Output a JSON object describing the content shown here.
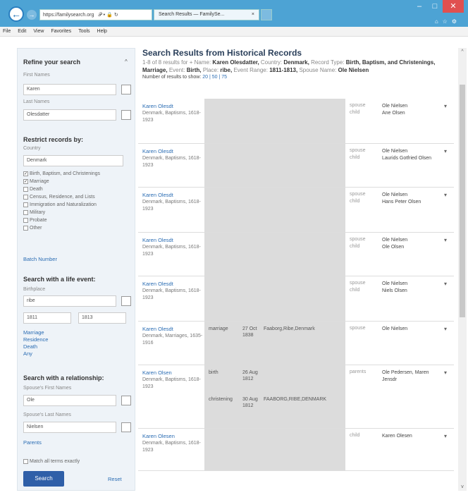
{
  "browser": {
    "address": "https://familysearch.org",
    "address_icons": "𝒫 ▾ 🔒 ↻",
    "tab_title": "Search Results — FamilySe...",
    "menu": [
      "File",
      "Edit",
      "View",
      "Favorites",
      "Tools",
      "Help"
    ]
  },
  "sidebar": {
    "refine_title": "Refine your search",
    "first_names_label": "First Names",
    "first_names_value": "Karen",
    "last_names_label": "Last Names",
    "last_names_value": "Olesdatter",
    "restrict_title": "Restrict records by:",
    "country_label": "Country",
    "country_value": "Denmark",
    "record_types": [
      {
        "label": "Birth, Baptism, and Christenings",
        "checked": true
      },
      {
        "label": "Marriage",
        "checked": true
      },
      {
        "label": "Death",
        "checked": false
      },
      {
        "label": "Census, Residence, and Lists",
        "checked": false
      },
      {
        "label": "Immigration and Naturalization",
        "checked": false
      },
      {
        "label": "Military",
        "checked": false
      },
      {
        "label": "Probate",
        "checked": false
      },
      {
        "label": "Other",
        "checked": false
      }
    ],
    "birth_number_link": "Batch Number",
    "life_event_title": "Search with a life event:",
    "birthplace_label": "Birthplace",
    "birthplace_value": "ribe",
    "year_from": "1811",
    "year_to": "1813",
    "event_links": [
      "Marriage",
      "Residence",
      "Death",
      "Any"
    ],
    "relationship_title": "Search with a relationship:",
    "spouse_first_label": "Spouse's First Names",
    "spouse_first_value": "Ole",
    "spouse_last_label": "Spouse's Last Names",
    "spouse_last_value": "Nielsen",
    "parents_link": "Parents",
    "match_exact_label": "Match all terms exactly",
    "search_button": "Search",
    "reset_link": "Reset"
  },
  "main": {
    "title": "Search Results from Historical Records",
    "summary_prefix": "1-8 of 8 results for",
    "summary_plus": "+ Name:",
    "summary_name": "Karen Olesdatter,",
    "summary_country_lbl": "Country:",
    "summary_country": "Denmark,",
    "summary_rt_lbl": "Record Type:",
    "summary_rt": "Birth, Baptism, and Christenings, Marriage,",
    "summary_event_lbl": "Event:",
    "summary_event": "Birth,",
    "summary_place_lbl": "Place:",
    "summary_place": "ribe,",
    "summary_range_lbl": "Event Range:",
    "summary_range": "1811-1813,",
    "summary_spouse_lbl": "Spouse Name:",
    "summary_spouse": "Ole Nielsen",
    "count_text": "Number of results to show:",
    "count_options": "20 | 50 | 75",
    "results": [
      {
        "name": "Karen Olesdt",
        "collection": "Denmark, Baptisms, 1618-1923",
        "rels": [
          {
            "label": "spouse",
            "value": "Ole Nielsen"
          },
          {
            "label": "child",
            "value": "Ane Olsen"
          }
        ],
        "events": []
      },
      {
        "name": "Karen Olesdt",
        "collection": "Denmark, Baptisms, 1618-1923",
        "rels": [
          {
            "label": "spouse",
            "value": "Ole Nielsen"
          },
          {
            "label": "child",
            "value": "Laurids Gotfried Olsen"
          }
        ],
        "events": []
      },
      {
        "name": "Karen Olesdt",
        "collection": "Denmark, Baptisms, 1618-1923",
        "rels": [
          {
            "label": "spouse",
            "value": "Ole Nielsen"
          },
          {
            "label": "child",
            "value": "Hans Peter Olsen"
          }
        ],
        "events": []
      },
      {
        "name": "Karen Olesdt",
        "collection": "Denmark, Baptisms, 1618-1923",
        "rels": [
          {
            "label": "spouse",
            "value": "Ole Nielsen"
          },
          {
            "label": "child",
            "value": "Ole Olsen"
          }
        ],
        "events": []
      },
      {
        "name": "Karen Olesdt",
        "collection": "Denmark, Baptisms, 1618-1923",
        "rels": [
          {
            "label": "spouse",
            "value": "Ole Nielsen"
          },
          {
            "label": "child",
            "value": "Niels Olsen"
          }
        ],
        "events": []
      },
      {
        "name": "Karen Olesdt",
        "collection": "Denmark, Marriages, 1635-1916",
        "rels": [
          {
            "label": "spouse",
            "value": "Ole Nielsen"
          }
        ],
        "events": [
          {
            "type": "marriage",
            "date": "27 Oct 1838",
            "place": "Faaborg,Ribe,Denmark"
          }
        ]
      },
      {
        "name": "Karen Olsen",
        "collection": "Denmark, Baptisms, 1618-1923",
        "rels": [
          {
            "label": "parents",
            "value": "Ole Pedersen, Maren Jensdr"
          }
        ],
        "events": [
          {
            "type": "birth",
            "date": "26 Aug 1812",
            "place": ""
          },
          {
            "type": "christening",
            "date": "30 Aug 1812",
            "place": "FAABORG,RIBE,DENMARK"
          }
        ]
      },
      {
        "name": "Karen Olesen",
        "collection": "Denmark, Baptisms, 1618-1923",
        "rels": [
          {
            "label": "child",
            "value": "Karen Olesen"
          }
        ],
        "events": []
      }
    ]
  }
}
